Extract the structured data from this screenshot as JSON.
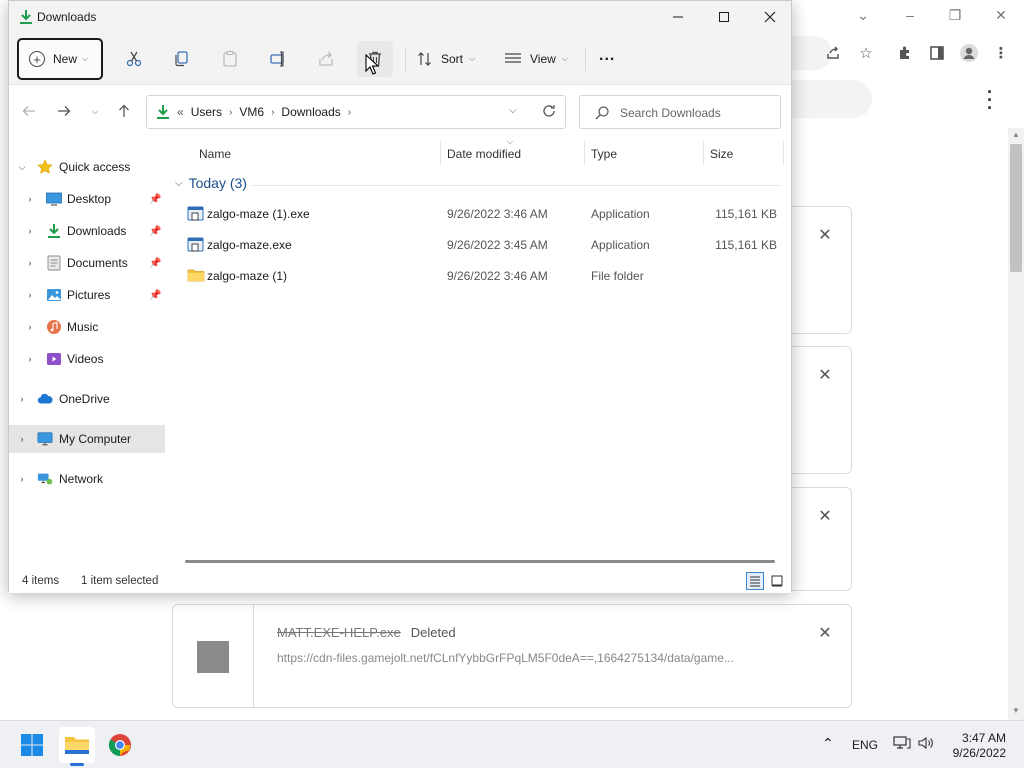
{
  "explorer": {
    "title": "Downloads",
    "commands": {
      "new_label": "New",
      "sort_label": "Sort",
      "view_label": "View",
      "more": "..."
    },
    "address": {
      "overflow": "«",
      "crumbs": [
        "Users",
        "VM6",
        "Downloads"
      ]
    },
    "search": {
      "placeholder": "Search Downloads"
    },
    "nav": [
      {
        "label": "Quick access",
        "icon": "star-icon"
      },
      {
        "label": "Desktop",
        "icon": "desktop-icon",
        "pinned": true
      },
      {
        "label": "Downloads",
        "icon": "download-icon",
        "pinned": true
      },
      {
        "label": "Documents",
        "icon": "documents-icon",
        "pinned": true
      },
      {
        "label": "Pictures",
        "icon": "pictures-icon",
        "pinned": true
      },
      {
        "label": "Music",
        "icon": "music-icon"
      },
      {
        "label": "Videos",
        "icon": "videos-icon"
      },
      {
        "label": "OneDrive",
        "icon": "cloud-icon"
      },
      {
        "label": "My Computer",
        "icon": "computer-icon",
        "selected": true
      },
      {
        "label": "Network",
        "icon": "network-icon"
      }
    ],
    "columns": {
      "name": "Name",
      "date": "Date modified",
      "type": "Type",
      "size": "Size"
    },
    "group": {
      "label": "Today (3)"
    },
    "files": [
      {
        "name": "zalgo-maze (1).exe",
        "date": "9/26/2022 3:46 AM",
        "type": "Application",
        "size": "115,161 KB"
      },
      {
        "name": "zalgo-maze.exe",
        "date": "9/26/2022 3:45 AM",
        "type": "Application",
        "size": "115,161 KB"
      },
      {
        "name": "zalgo-maze (1)",
        "date": "9/26/2022 3:46 AM",
        "type": "File folder",
        "size": ""
      }
    ],
    "status": {
      "items": "4 items",
      "selected": "1 item selected"
    }
  },
  "chrome_downloads": {
    "card": {
      "file_name": "MATT.EXE-HELP.exe",
      "status": "Deleted",
      "url": "https://cdn-files.gamejolt.net/fCLnfYybbGrFPqLM5F0deA==,1664275134/data/game..."
    }
  },
  "taskbar": {
    "language": "ENG",
    "time": "3:47 AM",
    "date": "9/26/2022"
  },
  "colors": {
    "accent": "#0067c0",
    "download_green": "#1e9e4a",
    "folder_yellow": "#f5c542",
    "selection": "#e5e5e5"
  }
}
